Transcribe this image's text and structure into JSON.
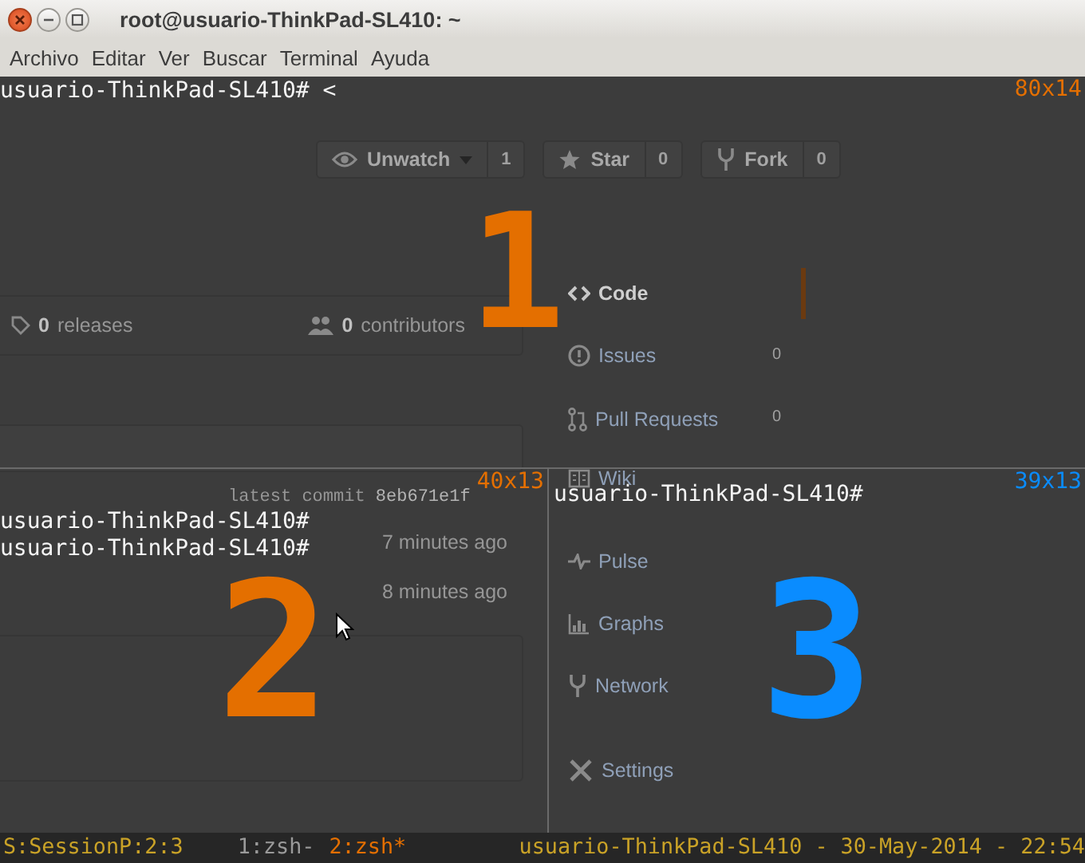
{
  "window": {
    "title": "root@usuario-ThinkPad-SL410: ~"
  },
  "menu": [
    "Archivo",
    "Editar",
    "Ver",
    "Buscar",
    "Terminal",
    "Ayuda"
  ],
  "background_page": {
    "buttons": [
      {
        "kind": "watch",
        "label": "Unwatch",
        "count": "1"
      },
      {
        "kind": "star",
        "label": "Star",
        "count": "0"
      },
      {
        "kind": "fork",
        "label": "Fork",
        "count": "0"
      }
    ],
    "stats": [
      {
        "kind": "releases",
        "number": "0",
        "label": "releases"
      },
      {
        "kind": "contributors",
        "number": "0",
        "label": "contributors"
      }
    ],
    "commit": {
      "label": "latest commit",
      "hash": "8eb671e1f"
    },
    "times": [
      "7 minutes ago",
      "8 minutes ago"
    ],
    "nav": [
      {
        "kind": "code",
        "label": "Code",
        "selected": true
      },
      {
        "kind": "issues",
        "label": "Issues",
        "count": "0",
        "selected": false
      },
      {
        "kind": "pull",
        "label": "Pull Requests",
        "count": "0",
        "selected": false
      },
      {
        "kind": "wiki",
        "label": "Wiki",
        "selected": false
      },
      {
        "kind": "pulse",
        "label": "Pulse",
        "selected": false
      },
      {
        "kind": "graphs",
        "label": "Graphs",
        "selected": false
      },
      {
        "kind": "network",
        "label": "Network",
        "selected": false
      },
      {
        "kind": "settings",
        "label": "Settings",
        "selected": false
      }
    ]
  },
  "panes": [
    {
      "number": "1",
      "size": "80x14",
      "color": "#e46f00",
      "rows": [
        {
          "kind": "prompt",
          "text": "usuario-ThinkPad-SL410# <"
        }
      ]
    },
    {
      "number": "2",
      "size": "40x13",
      "color": "#e46f00",
      "rows": [
        {
          "kind": "blank"
        },
        {
          "kind": "prompt",
          "text": "usuario-ThinkPad-SL410#"
        },
        {
          "kind": "prompt",
          "text": "usuario-ThinkPad-SL410#"
        }
      ]
    },
    {
      "number": "3",
      "size": "39x13",
      "color": "#0a8cff",
      "rows": [
        {
          "kind": "prompt",
          "text": "usuario-ThinkPad-SL410#"
        }
      ]
    }
  ],
  "status_bar": {
    "session": "S:SessionP:2:3",
    "windows": [
      {
        "label": "1:zsh-",
        "selected": false
      },
      {
        "label": "2:zsh*",
        "selected": true
      }
    ],
    "host": "usuario-ThinkPad-SL410 - 30-May-2014 - 22:54"
  }
}
